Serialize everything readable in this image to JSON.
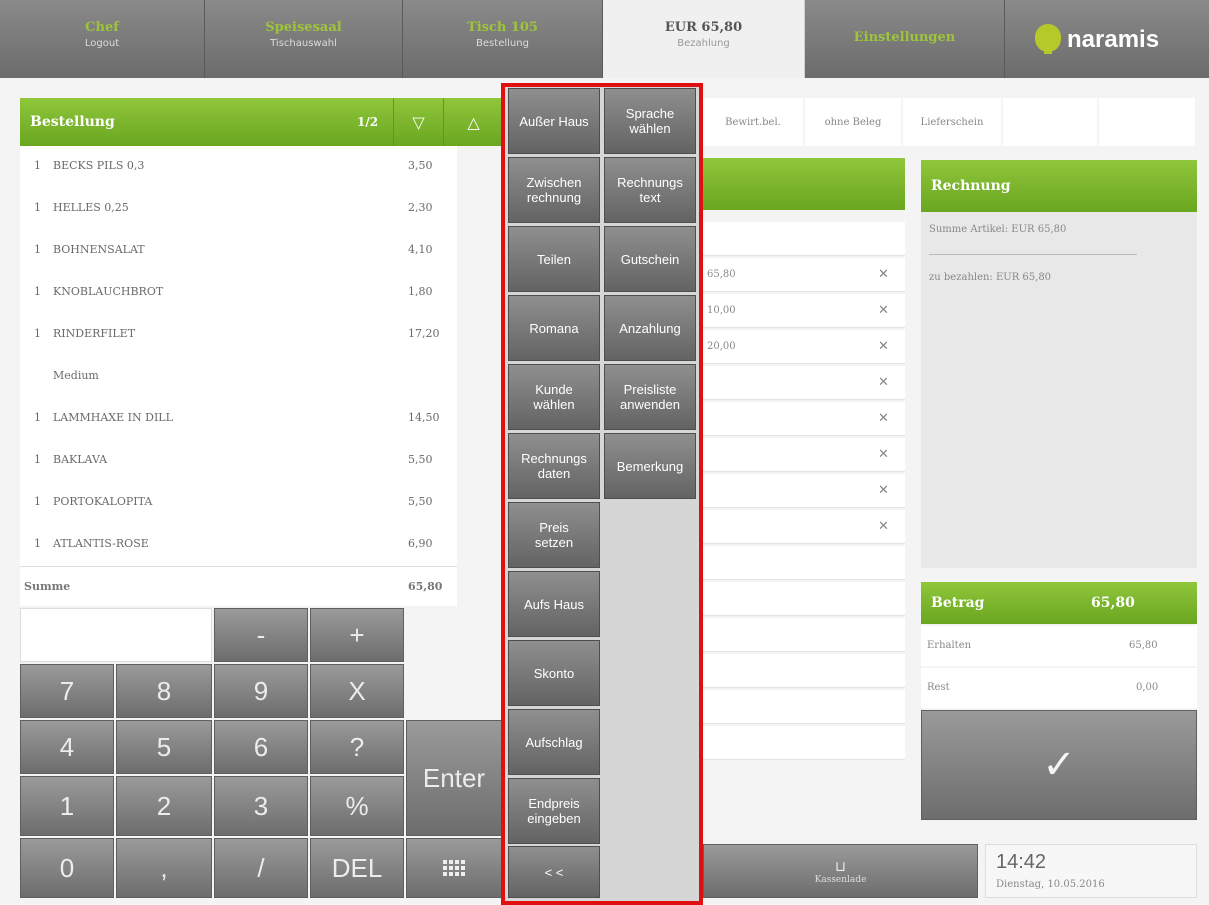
{
  "nav": {
    "tabs": [
      {
        "title": "Chef",
        "subtitle": "Logout"
      },
      {
        "title": "Speisesaal",
        "subtitle": "Tischauswahl"
      },
      {
        "title": "Tisch 105",
        "subtitle": "Bestellung"
      },
      {
        "title": "EUR 65,80",
        "subtitle": "Bezahlung"
      },
      {
        "title": "Einstellungen",
        "subtitle": ""
      }
    ],
    "brand": "naramis"
  },
  "order": {
    "header": "Bestellung",
    "page": "1/2",
    "items": [
      {
        "qty": "1",
        "name": "BECKS PILS 0,3",
        "price": "3,50"
      },
      {
        "qty": "1",
        "name": "HELLES 0,25",
        "price": "2,30"
      },
      {
        "qty": "1",
        "name": "BOHNENSALAT",
        "price": "4,10"
      },
      {
        "qty": "1",
        "name": "KNOBLAUCHBROT",
        "price": "1,80"
      },
      {
        "qty": "1",
        "name": "RINDERFILET",
        "price": "17,20"
      },
      {
        "qty": "",
        "name": "Medium",
        "price": ""
      },
      {
        "qty": "1",
        "name": "LAMMHAXE IN DILL",
        "price": "14,50"
      },
      {
        "qty": "1",
        "name": "BAKLAVA",
        "price": "5,50"
      },
      {
        "qty": "1",
        "name": "PORTOKALOPITA",
        "price": "5,50"
      },
      {
        "qty": "1",
        "name": "ATLANTIS-ROSE",
        "price": "6,90"
      }
    ],
    "sum_label": "Summe",
    "sum_value": "65,80"
  },
  "keypad": {
    "minus": "-",
    "plus": "+",
    "k7": "7",
    "k8": "8",
    "k9": "9",
    "kx": "X",
    "k4": "4",
    "k5": "5",
    "k6": "6",
    "kq": "?",
    "k1": "1",
    "k2": "2",
    "k3": "3",
    "kp": "%",
    "k0": "0",
    "kc": ",",
    "ks": "/",
    "kdel": "DEL",
    "enter": "Enter"
  },
  "menu": {
    "col1": [
      "Außer Haus",
      "Zwischen\nrechnung",
      "Teilen",
      "Romana",
      "Kunde\nwählen",
      "Rechnungs\ndaten",
      "Preis\nsetzen",
      "Aufs Haus",
      "Skonto",
      "Aufschlag",
      "Endpreis\neingeben",
      "< <"
    ],
    "col2": [
      "Sprache\nwählen",
      "Rechnungs\ntext",
      "Gutschein",
      "Anzahlung",
      "Preisliste\nanwenden",
      "Bemerkung"
    ]
  },
  "payment_tabs": [
    "Bewirt.bel.",
    "ohne Beleg",
    "Lieferschein"
  ],
  "middle_rows": [
    {
      "value": "",
      "x": ""
    },
    {
      "value": "65,80",
      "x": "✕"
    },
    {
      "value": "10,00",
      "x": "✕"
    },
    {
      "value": "20,00",
      "x": "✕"
    },
    {
      "value": "",
      "x": "✕"
    },
    {
      "value": "",
      "x": "✕"
    },
    {
      "value": "",
      "x": "✕"
    },
    {
      "value": "",
      "x": "✕"
    },
    {
      "value": "",
      "x": "✕"
    }
  ],
  "invoice": {
    "header": "Rechnung",
    "line1": "Summe Artikel: EUR 65,80",
    "line2": "zu bezahlen: EUR 65,80"
  },
  "amount": {
    "header": "Betrag",
    "value": "65,80",
    "received_label": "Erhalten",
    "received_value": "65,80",
    "rest_label": "Rest",
    "rest_value": "0,00"
  },
  "cashdrawer_label": "Kassenlade",
  "clock": {
    "time": "14:42",
    "date": "Dienstag, 10.05.2016"
  },
  "colors": {
    "accent": "#7cb62c",
    "highlight_border": "#e01010"
  }
}
